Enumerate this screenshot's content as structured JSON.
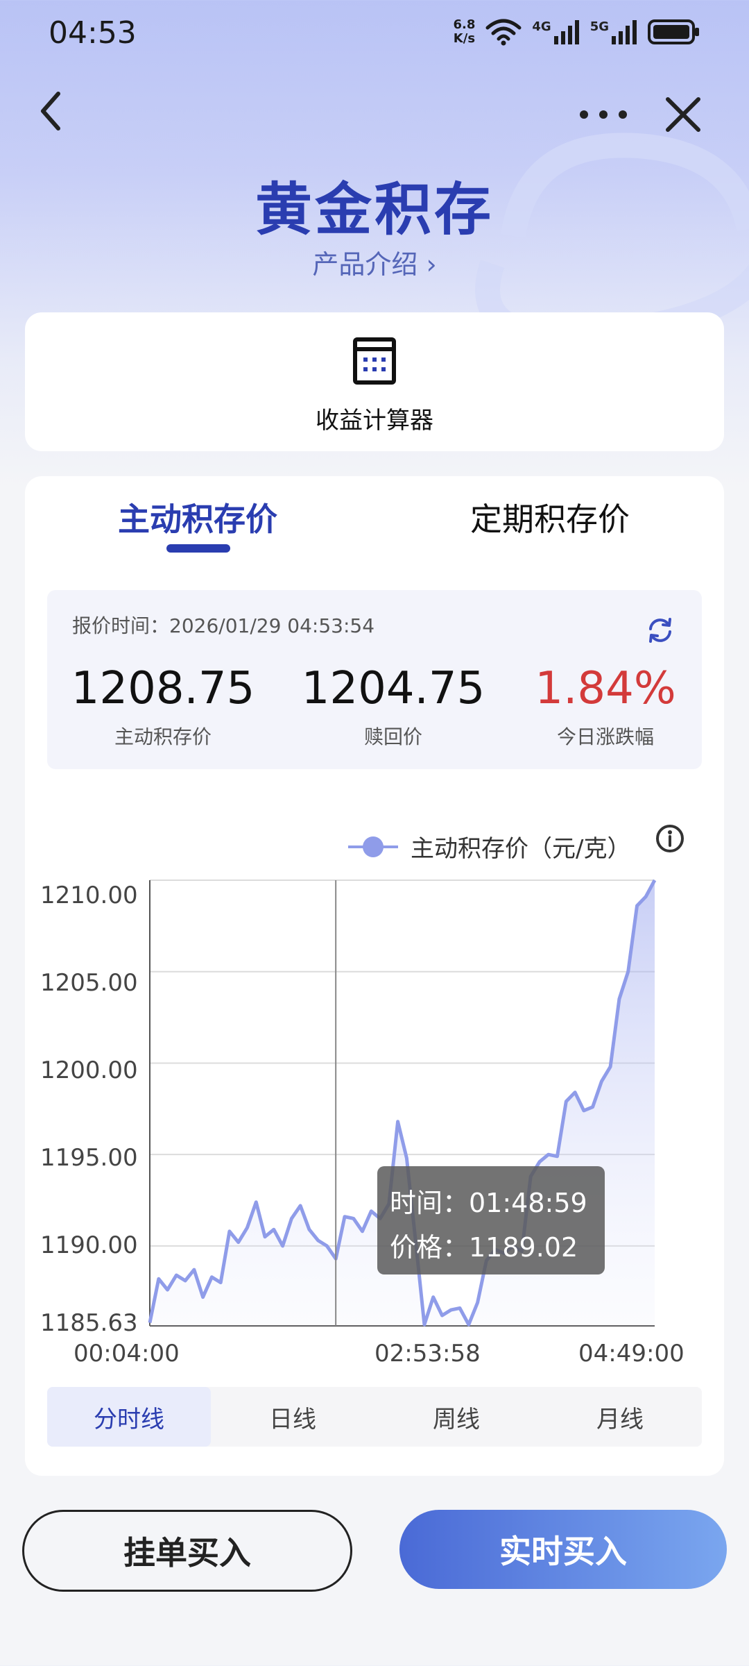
{
  "status_bar": {
    "time": "04:53",
    "net_speed_value": "6.8",
    "net_speed_unit": "K/s",
    "signal_4g": "4G",
    "signal_5g": "5G"
  },
  "header": {
    "title": "黄金积存",
    "subtitle": "产品介绍 ›"
  },
  "calculator": {
    "label": "收益计算器"
  },
  "tabs": [
    {
      "label": "主动积存价",
      "active": true
    },
    {
      "label": "定期积存价",
      "active": false
    }
  ],
  "quote": {
    "time_label": "报价时间：2026/01/29 04:53:54",
    "values": [
      {
        "value": "1208.75",
        "label": "主动积存价"
      },
      {
        "value": "1204.75",
        "label": "赎回价"
      },
      {
        "value": "1.84%",
        "label": "今日涨跌幅"
      }
    ]
  },
  "chart_legend": "主动积存价（元/克）",
  "tooltip": {
    "time": "时间：01:48:59",
    "price": "价格：1189.02"
  },
  "chart_data": {
    "type": "area",
    "title": "",
    "xlabel": "",
    "ylabel": "",
    "ylim": [
      1185.63,
      1210.0
    ],
    "y_ticks": [
      "1210.00",
      "1205.00",
      "1200.00",
      "1195.00",
      "1190.00",
      "1185.63"
    ],
    "x_ticks": [
      "00:04:00",
      "02:53:58",
      "04:49:00"
    ],
    "series": [
      {
        "name": "主动积存价（元/克）",
        "color": "#8f9ce9",
        "values": [
          1185.8,
          1188.2,
          1187.6,
          1188.4,
          1188.1,
          1188.7,
          1187.2,
          1188.3,
          1188.0,
          1190.8,
          1190.2,
          1191.0,
          1192.4,
          1190.5,
          1190.9,
          1190.0,
          1191.5,
          1192.2,
          1190.9,
          1190.3,
          1190.0,
          1189.3,
          1191.6,
          1191.5,
          1190.8,
          1191.9,
          1191.5,
          1192.3,
          1196.8,
          1194.8,
          1190.3,
          1185.7,
          1187.2,
          1186.2,
          1186.5,
          1186.6,
          1185.7,
          1186.9,
          1189.2,
          1189.8,
          1189.6,
          1190.0,
          1189.7,
          1193.8,
          1194.6,
          1195.0,
          1194.9,
          1197.9,
          1198.4,
          1197.4,
          1197.6,
          1199.0,
          1199.8,
          1203.5,
          1205.0,
          1208.6,
          1209.1,
          1210.0
        ]
      }
    ],
    "highlight": {
      "time": "01:48:59",
      "price": 1189.02
    }
  },
  "periods": [
    {
      "label": "分时线",
      "active": true
    },
    {
      "label": "日线",
      "active": false
    },
    {
      "label": "周线",
      "active": false
    },
    {
      "label": "月线",
      "active": false
    }
  ],
  "buttons": {
    "order": "挂单买入",
    "buy": "实时买入"
  }
}
